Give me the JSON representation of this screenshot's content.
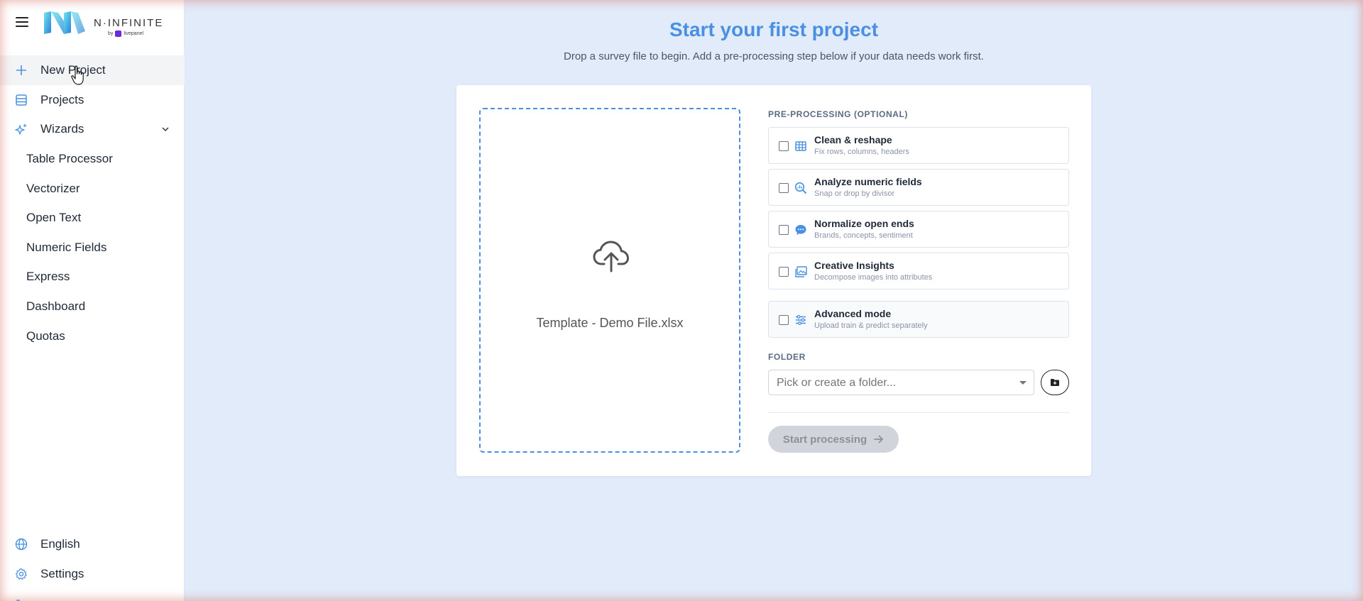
{
  "brand": {
    "name": "N·INFINITE",
    "by": "by",
    "partner": "livepanel"
  },
  "sidebar": {
    "items": [
      {
        "label": "New Project",
        "icon": "plus-icon"
      },
      {
        "label": "Projects",
        "icon": "list-icon"
      },
      {
        "label": "Wizards",
        "icon": "sparkles-icon"
      }
    ],
    "wizards": [
      {
        "label": "Table Processor"
      },
      {
        "label": "Vectorizer"
      },
      {
        "label": "Open Text"
      },
      {
        "label": "Numeric Fields"
      },
      {
        "label": "Express"
      },
      {
        "label": "Dashboard"
      },
      {
        "label": "Quotas"
      }
    ],
    "bottom": [
      {
        "label": "English",
        "icon": "globe-icon"
      },
      {
        "label": "Settings",
        "icon": "gear-icon"
      }
    ]
  },
  "main": {
    "title": "Start your first project",
    "subtitle": "Drop a survey file to begin. Add a pre-processing step below if your data needs work first.",
    "dropzone": {
      "file_name": "Template - Demo File.xlsx",
      "icon": "cloud-upload-icon"
    },
    "preprocessing_label": "PRE-PROCESSING (OPTIONAL)",
    "options": [
      {
        "title": "Clean & reshape",
        "desc": "Fix rows, columns, headers",
        "icon": "table-icon",
        "checked": false
      },
      {
        "title": "Analyze numeric fields",
        "desc": "Snap or drop by divisor",
        "icon": "analytics-search-icon",
        "checked": false
      },
      {
        "title": "Normalize open ends",
        "desc": "Brands, concepts, sentiment",
        "icon": "chat-bubble-icon",
        "checked": false
      },
      {
        "title": "Creative Insights",
        "desc": "Decompose images into attributes",
        "icon": "image-icon",
        "checked": false
      }
    ],
    "advanced": {
      "title": "Advanced mode",
      "desc": "Upload train & predict separately",
      "icon": "sliders-icon",
      "checked": false
    },
    "folder_label": "FOLDER",
    "folder_placeholder": "Pick or create a folder...",
    "start_label": "Start processing"
  },
  "colors": {
    "accent": "#4a90e2",
    "background": "#e1ebfa",
    "disabled_button": "#d1d5db"
  }
}
